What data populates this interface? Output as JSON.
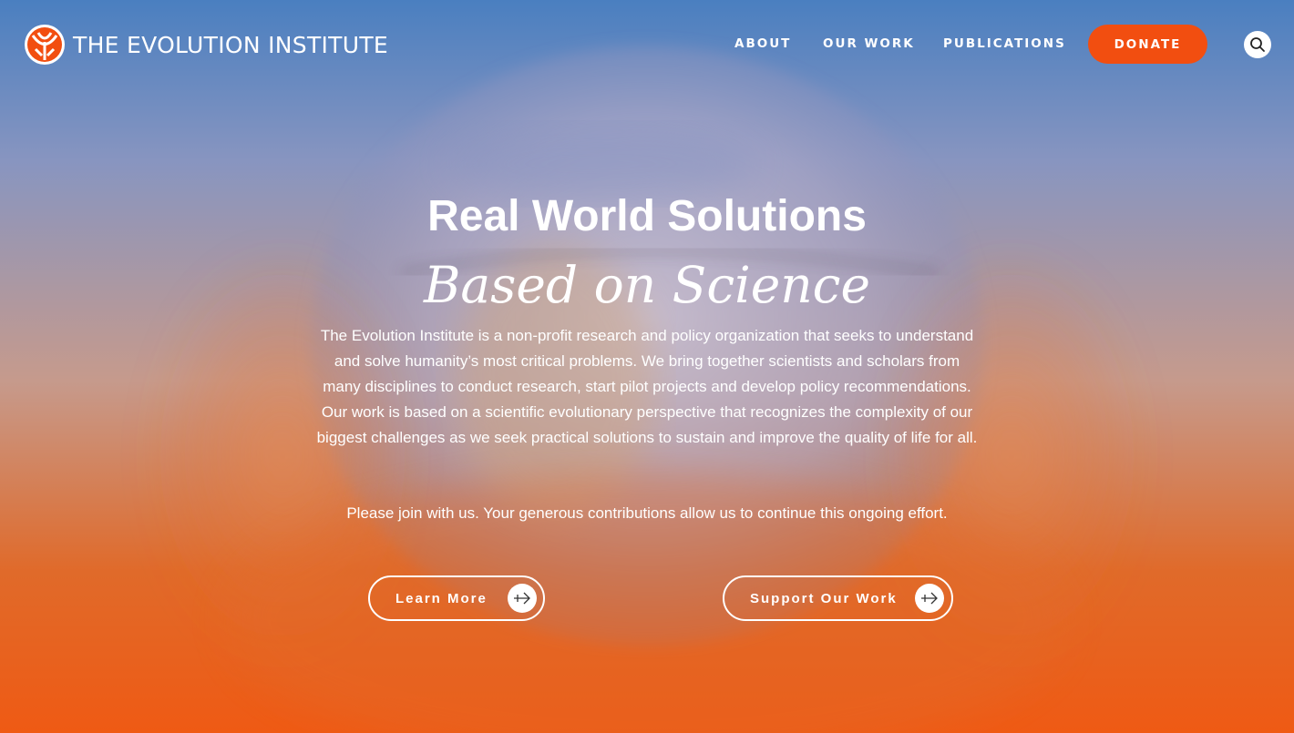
{
  "header": {
    "logo_text": "THE EVOLUTION INSTITUTE",
    "nav": [
      {
        "label": "ABOUT"
      },
      {
        "label": "OUR WORK"
      },
      {
        "label": "PUBLICATIONS"
      }
    ],
    "donate_label": "DONATE",
    "search_icon": "search-icon"
  },
  "hero": {
    "headline": "Real World Solutions",
    "subheadline": "Based on Science",
    "intro": "The Evolution Institute is a non-profit research and policy organization that seeks to understand and solve humanity’s most critical problems. We bring together scientists and scholars from many disciplines to conduct research, start pilot projects and develop policy recommendations. Our work is based on a scientific evolutionary perspective that recognizes the complexity of our biggest challenges as we seek practical solutions to sustain and improve the quality of life for all.",
    "call_to_action": "Please join with us. Your generous contributions allow us to continue this ongoing effort.",
    "buttons": [
      {
        "label": "Learn More",
        "icon": "arrow-right-icon"
      },
      {
        "label": "Support Our Work",
        "icon": "arrow-right-icon"
      }
    ]
  },
  "colors": {
    "accent": "#f24e10",
    "text": "#ffffff",
    "gradient_top": "#4a7fc0",
    "gradient_bottom": "#ef5a14"
  }
}
